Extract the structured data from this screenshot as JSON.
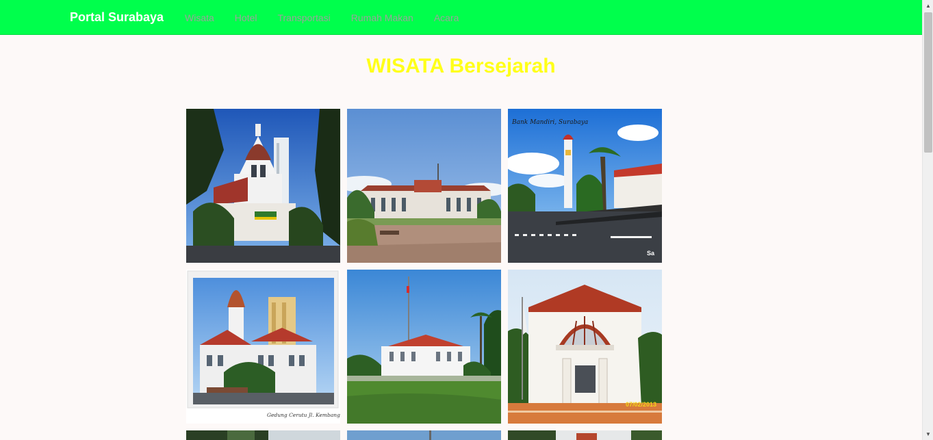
{
  "navbar": {
    "brand": "Portal Surabaya",
    "links": [
      "Wisata",
      "Hotel",
      "Transportasi",
      "Rumah Makan",
      "Acara"
    ]
  },
  "page": {
    "title": "WISATA Bersejarah"
  },
  "gallery": {
    "photos": [
      {
        "subject": "church-tower-building"
      },
      {
        "subject": "city-hall-plaza"
      },
      {
        "subject": "bank-mandiri-building",
        "caption": "Bank Mandiri, Surabaya",
        "watermark": "Sa"
      },
      {
        "subject": "gedung-cerutu-building",
        "caption": "Gedung Cerutu Jl. Kembang Jepun, Surabaya"
      },
      {
        "subject": "white-colonial-building-with-flag"
      },
      {
        "subject": "red-roof-station",
        "date_stamp": "07/02/2013"
      }
    ]
  },
  "colors": {
    "navbar": "#00ff4c",
    "brand_text": "#ffffff",
    "nav_link_text": "#9aa39c",
    "title_text": "#ffff1a",
    "background": "#fdf9f8"
  }
}
